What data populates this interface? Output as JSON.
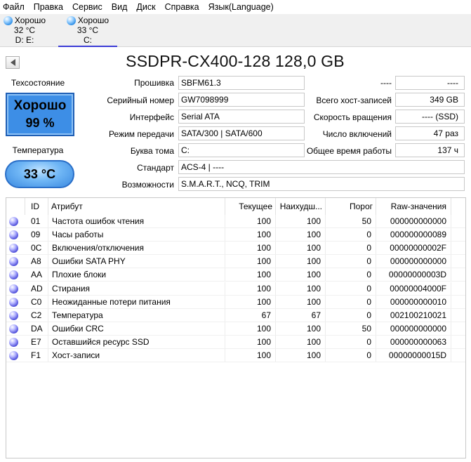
{
  "menu": [
    "Файл",
    "Правка",
    "Сервис",
    "Вид",
    "Диск",
    "Справка",
    "Язык(Language)"
  ],
  "disks": [
    {
      "status": "Хорошо",
      "temp": "32 °C",
      "letters": "D: E:",
      "active": false
    },
    {
      "status": "Хорошо",
      "temp": "33 °C",
      "letters": "C:",
      "active": true
    }
  ],
  "drive_title": "SSDPR-CX400-128 128,0 GB",
  "health": {
    "label": "Техсостояние",
    "status": "Хорошо",
    "percent": "99 %"
  },
  "temperature": {
    "label": "Температура",
    "value": "33 °C"
  },
  "info_left": [
    {
      "label": "Прошивка",
      "value": "SBFM61.3"
    },
    {
      "label": "Серийный номер",
      "value": "GW7098999"
    },
    {
      "label": "Интерфейс",
      "value": "Serial ATA"
    },
    {
      "label": "Режим передачи",
      "value": "SATA/300 | SATA/600"
    },
    {
      "label": "Буква тома",
      "value": "C:"
    },
    {
      "label": "Стандарт",
      "value": "ACS-4 | ----"
    },
    {
      "label": "Возможности",
      "value": "S.M.A.R.T., NCQ, TRIM"
    }
  ],
  "info_right_top": {
    "label": "----",
    "value": "----"
  },
  "info_right": [
    {
      "label": "Всего хост-записей",
      "value": "349 GB"
    },
    {
      "label": "Скорость вращения",
      "value": "---- (SSD)"
    },
    {
      "label": "Число включений",
      "value": "47 раз"
    },
    {
      "label": "Общее время работы",
      "value": "137 ч"
    }
  ],
  "table": {
    "headers": [
      "ID",
      "Атрибут",
      "Текущее",
      "Наихудш...",
      "Порог",
      "Raw-значения"
    ],
    "rows": [
      {
        "id": "01",
        "name": "Частота ошибок чтения",
        "cur": "100",
        "worst": "100",
        "thr": "50",
        "raw": "000000000000"
      },
      {
        "id": "09",
        "name": "Часы работы",
        "cur": "100",
        "worst": "100",
        "thr": "0",
        "raw": "000000000089"
      },
      {
        "id": "0C",
        "name": "Включения/отключения",
        "cur": "100",
        "worst": "100",
        "thr": "0",
        "raw": "00000000002F"
      },
      {
        "id": "A8",
        "name": "Ошибки SATA PHY",
        "cur": "100",
        "worst": "100",
        "thr": "0",
        "raw": "000000000000"
      },
      {
        "id": "AA",
        "name": "Плохие блоки",
        "cur": "100",
        "worst": "100",
        "thr": "0",
        "raw": "00000000003D"
      },
      {
        "id": "AD",
        "name": "Стирания",
        "cur": "100",
        "worst": "100",
        "thr": "0",
        "raw": "00000004000F"
      },
      {
        "id": "C0",
        "name": "Неожиданные потери питания",
        "cur": "100",
        "worst": "100",
        "thr": "0",
        "raw": "000000000010"
      },
      {
        "id": "C2",
        "name": "Температура",
        "cur": "67",
        "worst": "67",
        "thr": "0",
        "raw": "002100210021"
      },
      {
        "id": "DA",
        "name": "Ошибки CRC",
        "cur": "100",
        "worst": "100",
        "thr": "50",
        "raw": "000000000000"
      },
      {
        "id": "E7",
        "name": "Оставшийся ресурс SSD",
        "cur": "100",
        "worst": "100",
        "thr": "0",
        "raw": "000000000063"
      },
      {
        "id": "F1",
        "name": "Хост-записи",
        "cur": "100",
        "worst": "100",
        "thr": "0",
        "raw": "00000000015D"
      }
    ]
  }
}
